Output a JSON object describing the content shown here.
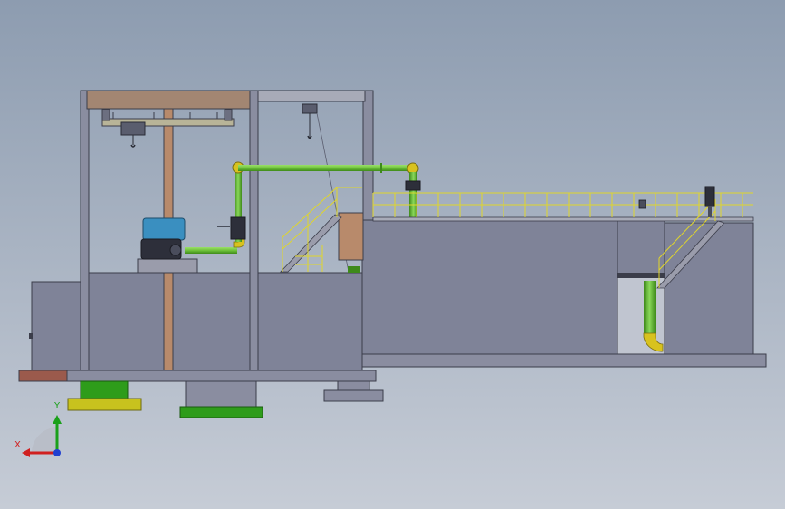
{
  "viewport": {
    "background_top": "#8d9cb0",
    "background_bottom": "#c6ccd6"
  },
  "colors": {
    "concrete": "#7f8398",
    "concrete_edge": "#3b3d4a",
    "steel": "#8a8da0",
    "timber": "#b88a6b",
    "pipe_green": "#6ec23a",
    "pipe_green_dark": "#3e8a1a",
    "pipe_yellow": "#d8c21e",
    "railing": "#e0d62a",
    "footing_green": "#2e9c1a",
    "footing_yellow": "#c8c21e",
    "soil": "#9b5a4c",
    "motor_blue": "#3a8fc0"
  },
  "triad": {
    "y_label": "Y",
    "x_label": "X",
    "y_color": "#1aa01a",
    "x_color": "#d02020",
    "z_color": "#2040d0"
  }
}
